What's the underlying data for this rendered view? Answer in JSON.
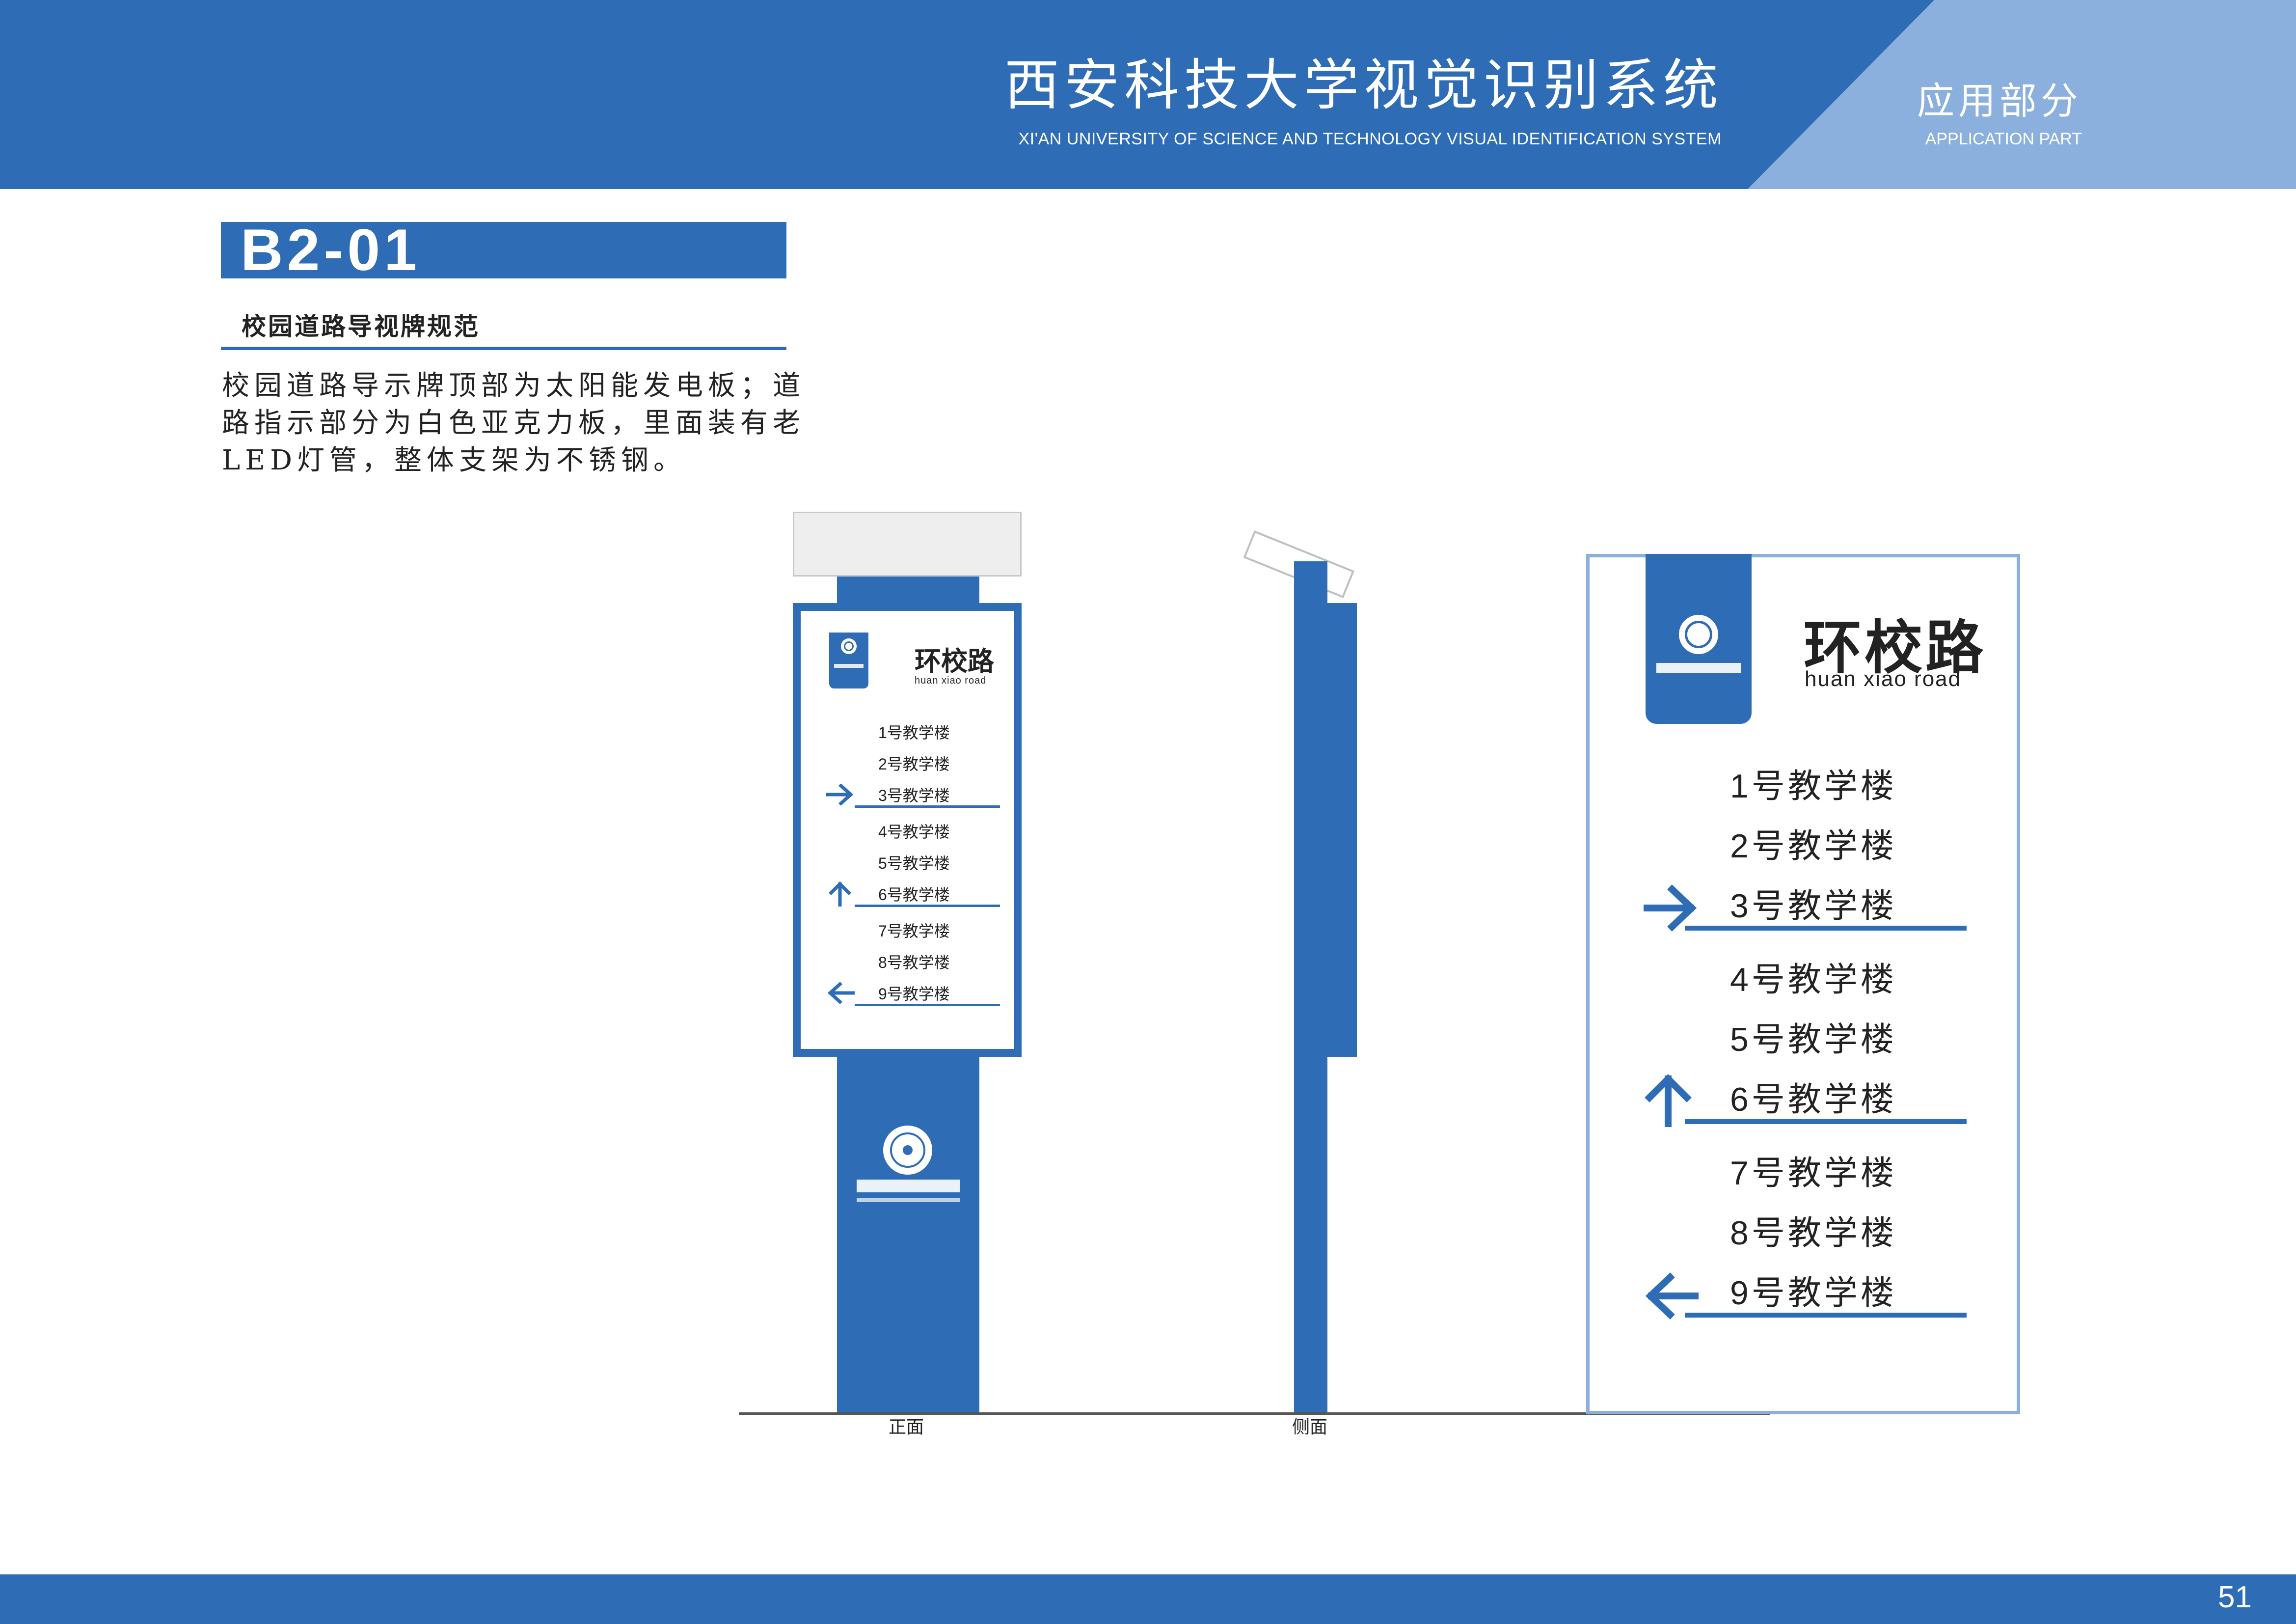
{
  "header": {
    "title": "西安科技大学视觉识别系统",
    "subtitle": "XI'AN UNIVERSITY OF SCIENCE AND TECHNOLOGY VISUAL IDENTIFICATION SYSTEM",
    "section_title": "应用部分",
    "section_subtitle": "APPLICATION PART"
  },
  "section": {
    "code": "B2-01",
    "heading": "校园道路导视牌规范",
    "description_lines": [
      "校园道路导示牌顶部为太阳能发电板；道",
      "路指示部分为白色亚克力板，里面装有老",
      "LED灯管，整体支架为不锈钢。"
    ]
  },
  "views": {
    "front_label": "正面",
    "side_label": "侧面"
  },
  "sign": {
    "road_name": "环校路",
    "road_pinyin": "huan xiao road",
    "groups": [
      {
        "direction": "right",
        "items": [
          "1号教学楼",
          "2号教学楼",
          "3号教学楼"
        ]
      },
      {
        "direction": "up",
        "items": [
          "4号教学楼",
          "5号教学楼",
          "6号教学楼"
        ]
      },
      {
        "direction": "left",
        "items": [
          "7号教学楼",
          "8号教学楼",
          "9号教学楼"
        ]
      }
    ]
  },
  "colors": {
    "brand_blue": "#2e6db5",
    "light_blue": "#8bb0dd"
  },
  "footer": {
    "page_number": "51"
  }
}
